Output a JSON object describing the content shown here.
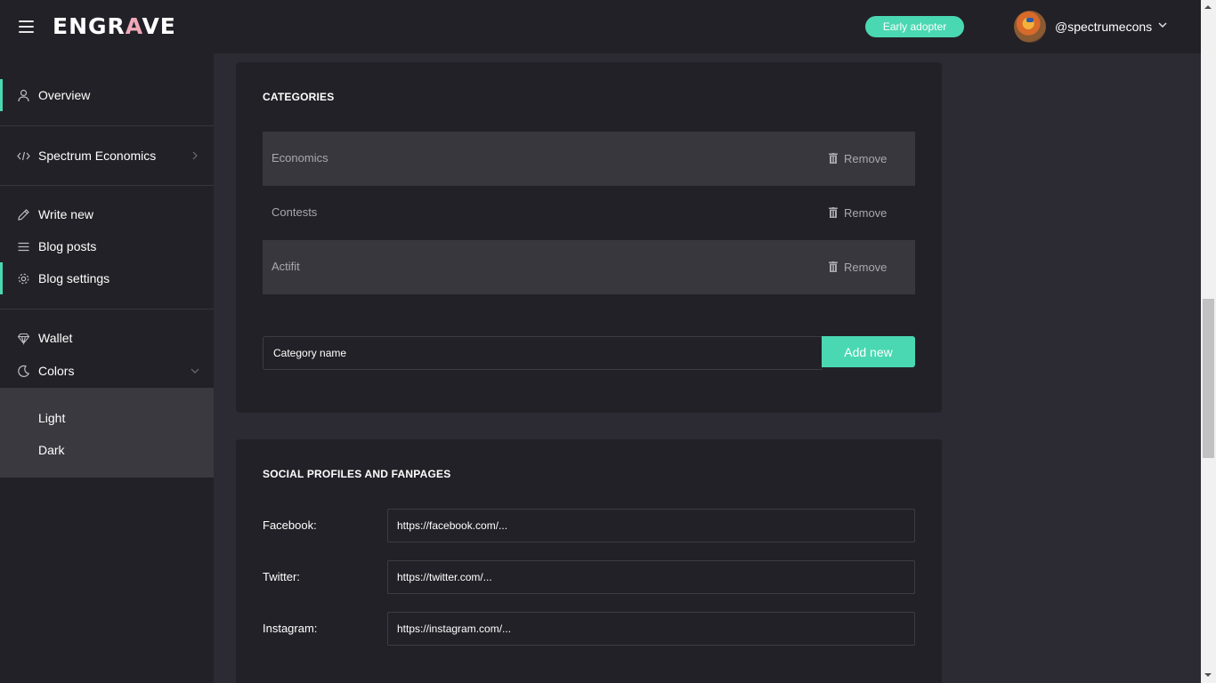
{
  "header": {
    "logo_text_start": "ENGR",
    "logo_text_accent": "A",
    "logo_text_end": "VE",
    "badge": "Early adopter",
    "username": "@spectrumecons"
  },
  "sidebar": {
    "items": [
      {
        "label": "Overview",
        "icon": "user-icon",
        "active": true
      },
      {
        "label": "Spectrum Economics",
        "icon": "code-icon",
        "active": false
      },
      {
        "label": "Write new",
        "icon": "pencil-icon",
        "active": false
      },
      {
        "label": "Blog posts",
        "icon": "list-icon",
        "active": false
      },
      {
        "label": "Blog settings",
        "icon": "gear-icon",
        "active": true
      },
      {
        "label": "Wallet",
        "icon": "diamond-icon",
        "active": false
      },
      {
        "label": "Colors",
        "icon": "moon-icon",
        "active": false
      }
    ],
    "colors_submenu": [
      "Light",
      "Dark"
    ]
  },
  "categories": {
    "title": "CATEGORIES",
    "items": [
      {
        "name": "Economics",
        "remove_label": "Remove"
      },
      {
        "name": "Contests",
        "remove_label": "Remove"
      },
      {
        "name": "Actifit",
        "remove_label": "Remove"
      }
    ],
    "input_placeholder": "Category name",
    "add_button": "Add new"
  },
  "social": {
    "title": "SOCIAL PROFILES AND FANPAGES",
    "fields": [
      {
        "label": "Facebook:",
        "placeholder": "https://facebook.com/..."
      },
      {
        "label": "Twitter:",
        "placeholder": "https://twitter.com/..."
      },
      {
        "label": "Instagram:",
        "placeholder": "https://instagram.com/..."
      }
    ]
  },
  "colors": {
    "accent": "#4ad8b2",
    "background": "#2c2b33",
    "panel": "#222127"
  }
}
